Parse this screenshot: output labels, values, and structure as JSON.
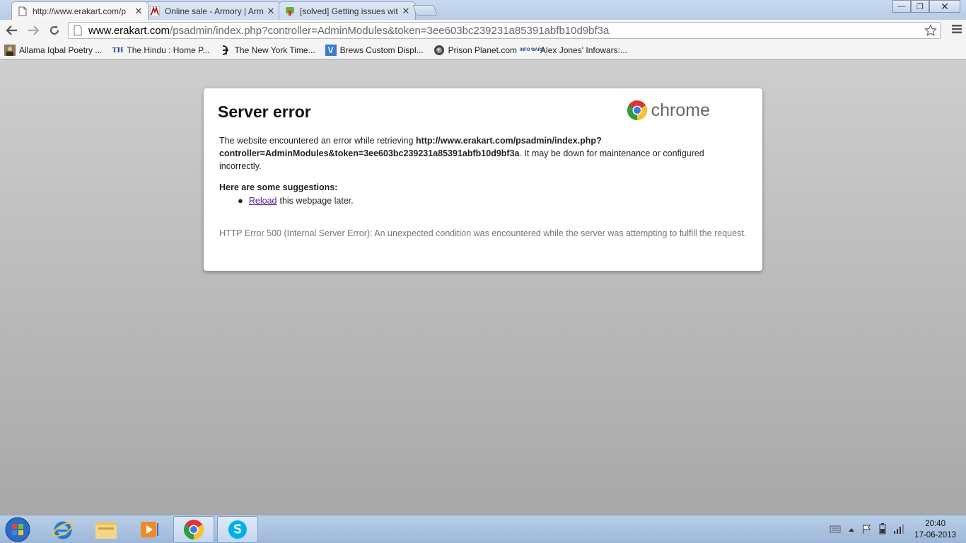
{
  "tabs": [
    {
      "title": "http://www.erakart.com/p",
      "favicon": "page-icon",
      "active": true
    },
    {
      "title": "Online sale - Armory | Arm",
      "favicon": "armory-icon",
      "active": false
    },
    {
      "title": "[solved] Getting issues wit",
      "favicon": "forum-icon",
      "active": false
    }
  ],
  "tab_close_glyph": "✕",
  "window_controls": {
    "minimize": "—",
    "restore": "❐",
    "close": "✕"
  },
  "toolbar": {
    "url_host": "www.erakart.com",
    "url_path": "/psadmin/index.php?controller=AdminModules&token=3ee603bc239231a85391abfb10d9bf3a"
  },
  "bookmarks": [
    {
      "label": "Allama Iqbal Poetry ...",
      "icon": "portrait-icon"
    },
    {
      "label": "The Hindu : Home P...",
      "icon": "th-icon"
    },
    {
      "label": "The New York Time...",
      "icon": "nyt-icon"
    },
    {
      "label": "Brews Custom Displ...",
      "icon": "v-icon"
    },
    {
      "label": "Prison Planet.com",
      "icon": "globe-icon"
    },
    {
      "label": "Alex Jones' Infowars:...",
      "icon": "infowars-icon"
    }
  ],
  "bookmark_badges": {
    "th": "TH",
    "v": "V",
    "info": "INFO WARS"
  },
  "error": {
    "title": "Server error",
    "brand": "chrome",
    "intro": "The website encountered an error while retrieving ",
    "url_line1": "http://www.erakart.com/psadmin/index.php?",
    "url_line2": "controller=AdminModules&token=3ee603bc239231a85391abfb10d9bf3a",
    "outro": ". It may be down for maintenance or configured incorrectly.",
    "suggestions_heading": "Here are some suggestions:",
    "suggestion_link": "Reload",
    "suggestion_rest": "this webpage later.",
    "details": "HTTP Error 500 (Internal Server Error): An unexpected condition was encountered while the server was attempting to fulfill the request."
  },
  "taskbar": {
    "apps": [
      "internet-explorer-icon",
      "file-explorer-icon",
      "media-player-icon",
      "chrome-icon",
      "skype-icon"
    ],
    "time": "20:40",
    "date": "17-06-2013"
  },
  "colors": {
    "link_visited": "#551a8b",
    "tab_bg": "#c9daf0",
    "content_bg": "#b8b8b8"
  }
}
